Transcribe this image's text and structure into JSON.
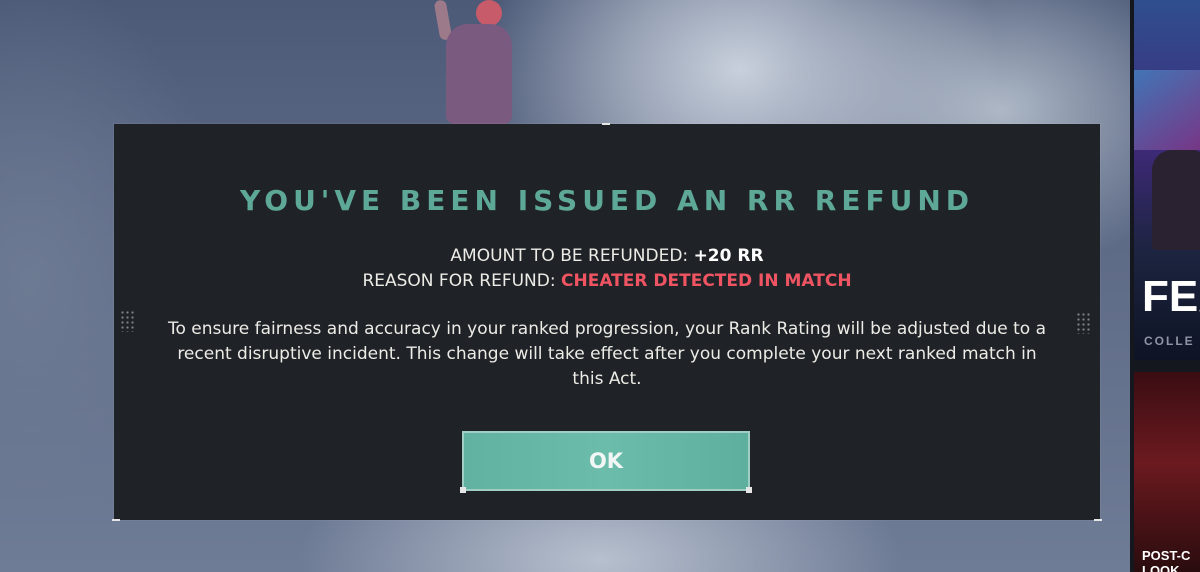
{
  "dialog": {
    "title": "YOU'VE BEEN ISSUED AN RR REFUND",
    "amount_label": "AMOUNT TO BE REFUNDED:",
    "amount_value": "+20 RR",
    "reason_label": "REASON FOR REFUND:",
    "reason_value": "CHEATER DETECTED IN MATCH",
    "body": "To ensure fairness and accuracy in your ranked progression, your Rank Rating will be adjusted due to a recent disruptive incident. This change will take effect after you complete your next ranked match in this Act.",
    "ok_label": "OK"
  },
  "side_panel": {
    "promo_1": {
      "title": "FEA",
      "subtitle": "COLLE"
    },
    "promo_2": {
      "title": "POST-C LOOK"
    }
  },
  "colors": {
    "title_teal": "#5ea897",
    "reason_red": "#ef5462",
    "button_teal": "#6cbcab",
    "dialog_bg": "#1f2327"
  }
}
